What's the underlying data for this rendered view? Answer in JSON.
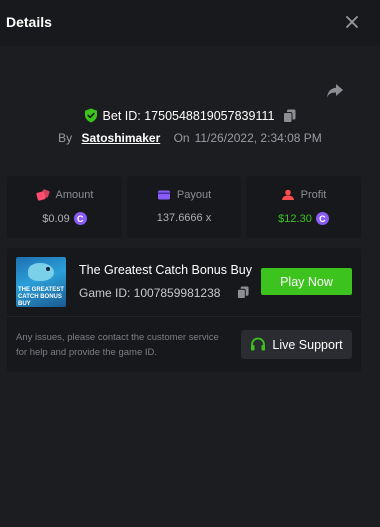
{
  "header": {
    "title": "Details"
  },
  "bet": {
    "label": "Bet ID: 1750548819057839111",
    "by_label": "By",
    "user": "Satoshimaker",
    "on_label": "On",
    "date": "11/26/2022, 2:34:08 PM"
  },
  "stats": {
    "amount": {
      "label": "Amount",
      "value": "$0.09",
      "icon": "dice-icon",
      "color": "#ff4d6d"
    },
    "payout": {
      "label": "Payout",
      "value": "137.6666 x",
      "icon": "wallet-icon",
      "color": "#8a5cf6"
    },
    "profit": {
      "label": "Profit",
      "value": "$12.30",
      "icon": "profit-icon",
      "color": "#ff4d4d",
      "value_color": "#3cc31d"
    }
  },
  "coin_symbol": "C",
  "game": {
    "thumb_caption": "THE GREATEST CATCH BONUS BUY",
    "title": "The Greatest Catch Bonus Buy",
    "id_label": "Game ID: 1007859981238",
    "play_label": "Play Now"
  },
  "support": {
    "notice": "Any issues, please contact the customer service for help and provide the game ID.",
    "button_label": "Live Support"
  },
  "colors": {
    "accent_green": "#3cc31d",
    "coin_purple": "#8a5cf6",
    "background": "#1c1d20"
  }
}
